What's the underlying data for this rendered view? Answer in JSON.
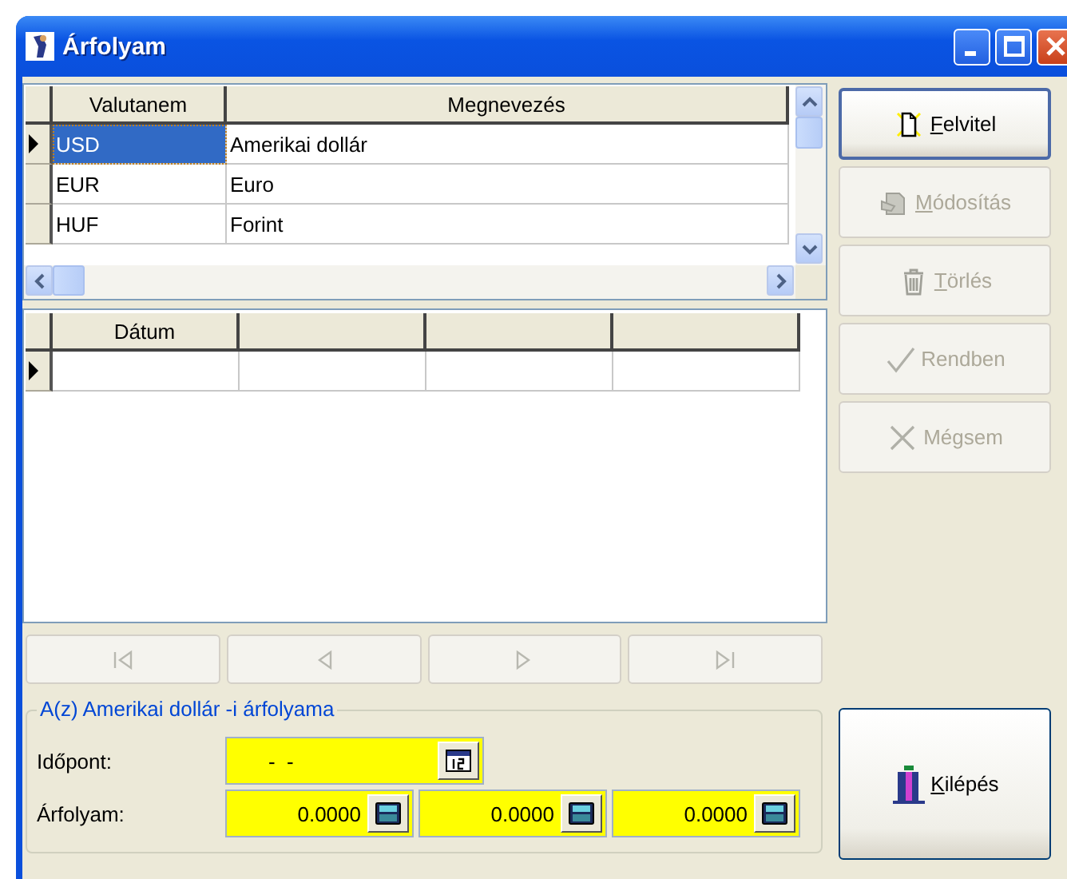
{
  "window": {
    "title": "Árfolyam"
  },
  "currency_grid": {
    "columns": [
      "Valutanem",
      "Megnevezés"
    ],
    "rows": [
      {
        "cells": [
          "USD",
          "Amerikai dollár"
        ],
        "selected": true
      },
      {
        "cells": [
          "EUR",
          "Euro"
        ],
        "selected": false
      },
      {
        "cells": [
          "HUF",
          "Forint"
        ],
        "selected": false
      }
    ]
  },
  "rate_grid": {
    "columns": [
      "Dátum"
    ]
  },
  "nav_buttons": [
    {
      "kind": "first",
      "disabled": true
    },
    {
      "kind": "prev",
      "disabled": true
    },
    {
      "kind": "next",
      "disabled": true
    },
    {
      "kind": "last",
      "disabled": true
    }
  ],
  "side_buttons": [
    {
      "kind": "new",
      "label": "Felvitel",
      "disabled": false,
      "default": true,
      "mnemonic": true
    },
    {
      "kind": "edit",
      "label": "Módosítás",
      "disabled": true,
      "default": false,
      "mnemonic": true
    },
    {
      "kind": "delete",
      "label": "Törlés",
      "disabled": true,
      "default": false,
      "mnemonic": true
    },
    {
      "kind": "ok",
      "label": "Rendben",
      "disabled": true,
      "default": false,
      "mnemonic": false
    },
    {
      "kind": "cancel",
      "label": "Mégsem",
      "disabled": true,
      "default": false,
      "mnemonic": false
    }
  ],
  "rate_group": {
    "title": "A(z) Amerikai dollár -i árfolyama",
    "date_label": "Időpont:",
    "date_value": "-  -",
    "rate_label": "Árfolyam:",
    "rates": [
      "0.0000",
      "0.0000",
      "0.0000"
    ]
  },
  "exit_button": {
    "label": "Kilépés",
    "mnemonic": true
  }
}
